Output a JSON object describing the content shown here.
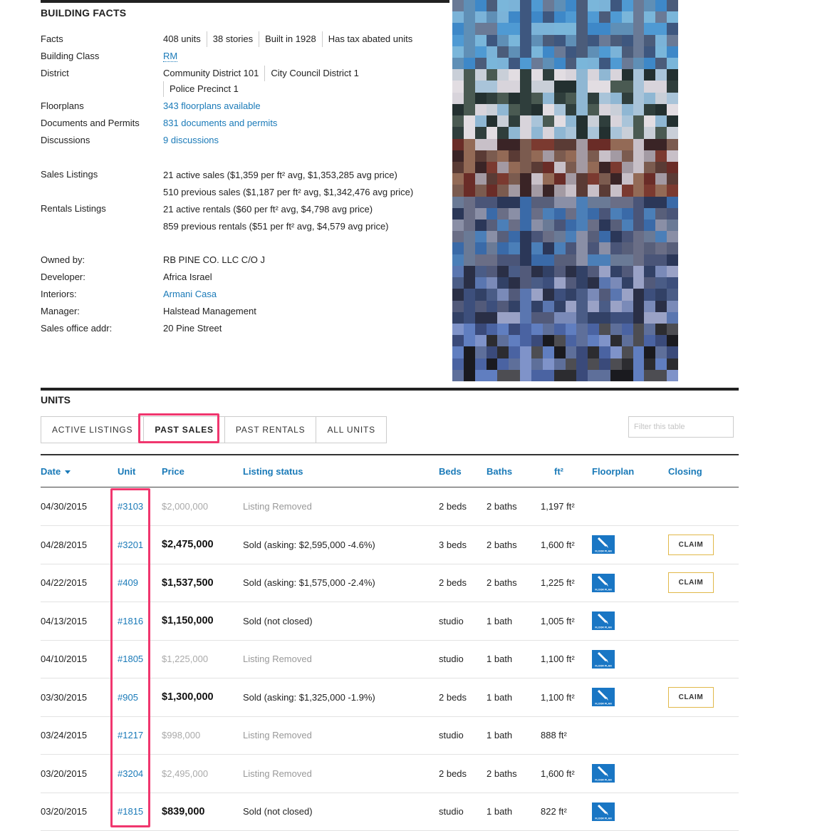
{
  "facts": {
    "title": "BUILDING FACTS",
    "rows": [
      {
        "label": "Facts",
        "chips": [
          "408 units",
          "38 stories",
          "Built in 1928",
          "Has tax abated units"
        ]
      },
      {
        "label": "Building Class",
        "link": "RM"
      },
      {
        "label": "District",
        "chips": [
          "Community District 101",
          "City Council District 1",
          "Police Precinct 1"
        ]
      },
      {
        "label": "Floorplans",
        "link": "343 floorplans available"
      },
      {
        "label": "Documents and Permits",
        "link": "831 documents and permits"
      },
      {
        "label": "Discussions",
        "link": "9 discussions"
      }
    ],
    "sales_label": "Sales Listings",
    "sales_lines": [
      "21 active sales ($1,359 per ft² avg, $1,353,285 avg price)",
      "510 previous sales ($1,187 per ft² avg, $1,342,476 avg price)"
    ],
    "rentals_label": "Rentals Listings",
    "rentals_lines": [
      "21 active rentals ($60 per ft² avg, $4,798 avg price)",
      "859 previous rentals ($51 per ft² avg, $4,579 avg price)"
    ],
    "people": [
      {
        "label": "Owned by:",
        "value": "RB PINE CO. LLC C/O J"
      },
      {
        "label": "Developer:",
        "value": "Africa Israel"
      },
      {
        "label": "Interiors:",
        "value": "Armani Casa",
        "is_link": true
      },
      {
        "label": "Manager:",
        "value": "Halstead Management"
      },
      {
        "label": "Sales office addr:",
        "value": "20 Pine Street"
      }
    ]
  },
  "units": {
    "title": "UNITS",
    "tabs": [
      "ACTIVE LISTINGS",
      "PAST SALES",
      "PAST RENTALS",
      "ALL UNITS"
    ],
    "active_tab": "PAST SALES",
    "filter_placeholder": "Filter this table",
    "columns": [
      "Date",
      "Unit",
      "Price",
      "Listing status",
      "Beds",
      "Baths",
      "ft²",
      "Floorplan",
      "Closing"
    ],
    "sort_column": "Date",
    "sort_direction": "descending",
    "rows": [
      {
        "date": "04/30/2015",
        "unit": "#3103",
        "price": "$2,000,000",
        "price_muted": true,
        "status": "Listing Removed",
        "status_muted": true,
        "beds": "2 beds",
        "baths": "2 baths",
        "sqft": "1,197 ft²",
        "floorplan": false,
        "claim": false
      },
      {
        "date": "04/28/2015",
        "unit": "#3201",
        "price": "$2,475,000",
        "price_muted": false,
        "status": "Sold (asking: $2,595,000 -4.6%)",
        "status_muted": false,
        "beds": "3 beds",
        "baths": "2 baths",
        "sqft": "1,600 ft²",
        "floorplan": true,
        "claim": true
      },
      {
        "date": "04/22/2015",
        "unit": "#409",
        "price": "$1,537,500",
        "price_muted": false,
        "status": "Sold (asking: $1,575,000 -2.4%)",
        "status_muted": false,
        "beds": "2 beds",
        "baths": "2 baths",
        "sqft": "1,225 ft²",
        "floorplan": true,
        "claim": true
      },
      {
        "date": "04/13/2015",
        "unit": "#1816",
        "price": "$1,150,000",
        "price_muted": false,
        "status": "Sold (not closed)",
        "status_muted": false,
        "beds": "studio",
        "baths": "1 bath",
        "sqft": "1,005 ft²",
        "floorplan": true,
        "claim": false
      },
      {
        "date": "04/10/2015",
        "unit": "#1805",
        "price": "$1,225,000",
        "price_muted": true,
        "status": "Listing Removed",
        "status_muted": true,
        "beds": "studio",
        "baths": "1 bath",
        "sqft": "1,100 ft²",
        "floorplan": true,
        "claim": false
      },
      {
        "date": "03/30/2015",
        "unit": "#905",
        "price": "$1,300,000",
        "price_muted": false,
        "status": "Sold (asking: $1,325,000 -1.9%)",
        "status_muted": false,
        "beds": "2 beds",
        "baths": "1 bath",
        "sqft": "1,100 ft²",
        "floorplan": true,
        "claim": true
      },
      {
        "date": "03/24/2015",
        "unit": "#1217",
        "price": "$998,000",
        "price_muted": true,
        "status": "Listing Removed",
        "status_muted": true,
        "beds": "studio",
        "baths": "1 bath",
        "sqft": "888 ft²",
        "floorplan": false,
        "claim": false
      },
      {
        "date": "03/20/2015",
        "unit": "#3204",
        "price": "$2,495,000",
        "price_muted": true,
        "status": "Listing Removed",
        "status_muted": true,
        "beds": "2 beds",
        "baths": "2 baths",
        "sqft": "1,600 ft²",
        "floorplan": true,
        "claim": false
      },
      {
        "date": "03/20/2015",
        "unit": "#1815",
        "price": "$839,000",
        "price_muted": false,
        "status": "Sold (not closed)",
        "status_muted": false,
        "beds": "studio",
        "baths": "1 bath",
        "sqft": "822 ft²",
        "floorplan": true,
        "claim": false
      }
    ],
    "claim_label": "CLAIM",
    "floorplan_icon_text": "FLOOR PLAN"
  },
  "colors": {
    "link": "#1a7ab8",
    "highlight": "#f0366e",
    "floorplan_icon": "#1976c4",
    "claim_border": "#e1b84a"
  }
}
